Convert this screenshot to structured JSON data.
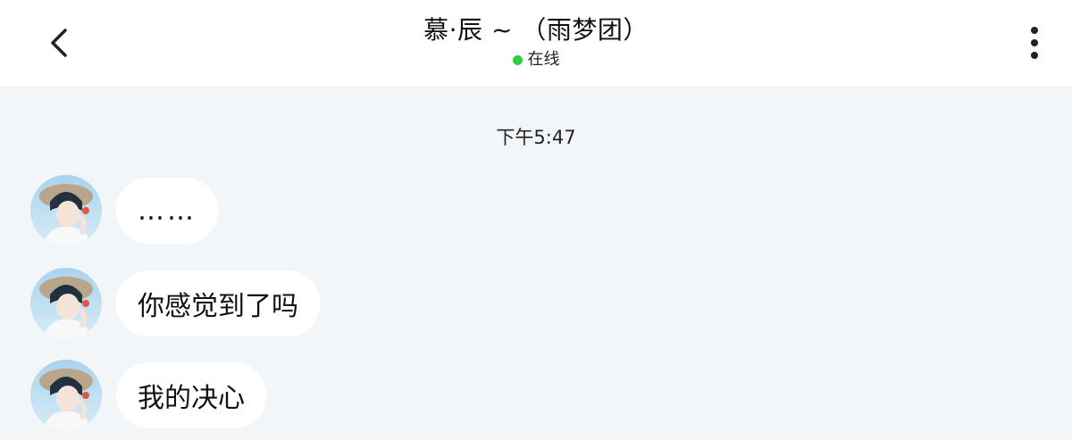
{
  "header": {
    "title": "慕·辰 ~ （雨梦团）",
    "status_text": "在线",
    "status_color": "#2ecc40",
    "back_icon": "chevron-left-icon",
    "more_icon": "more-vertical-icon"
  },
  "chat": {
    "timestamp": "下午5:47",
    "messages": [
      {
        "text": "……"
      },
      {
        "text": "你感觉到了吗"
      },
      {
        "text": "我的决心"
      }
    ]
  }
}
